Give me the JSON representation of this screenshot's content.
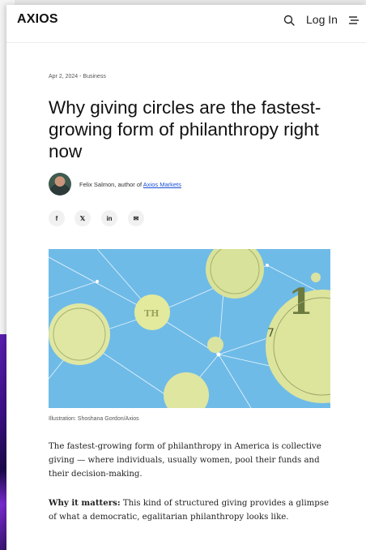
{
  "header": {
    "logo": "AXIOS",
    "login_label": "Log In",
    "search_icon": "search-icon",
    "menu_icon": "menu-icon"
  },
  "article": {
    "dateline": "Apr 2, 2024 - Business",
    "headline": "Why giving circles are the fastest-growing form of philanthropy right now",
    "author_text": "Felix Salmon, author of ",
    "author_link": "Axios Markets",
    "share_icons": [
      "facebook-icon",
      "x-icon",
      "linkedin-icon",
      "email-icon"
    ],
    "share_glyphs": [
      "f",
      "𝕏",
      "in",
      "✉"
    ],
    "image_caption": "Illustration: Shoshana Gordon/Axios",
    "paragraph1": "The fastest-growing form of philanthropy in America is collective giving — where individuals, usually women, pool their funds and their decision-making.",
    "paragraph2_lead": "Why it matters:",
    "paragraph2_rest": " This kind of structured giving provides a glimpse of what a democratic, egalitarian philanthropy looks like."
  },
  "colors": {
    "link": "#1a4fd6",
    "hero_sky": "#67b6e6",
    "hero_yellow": "#dfe7a3"
  }
}
